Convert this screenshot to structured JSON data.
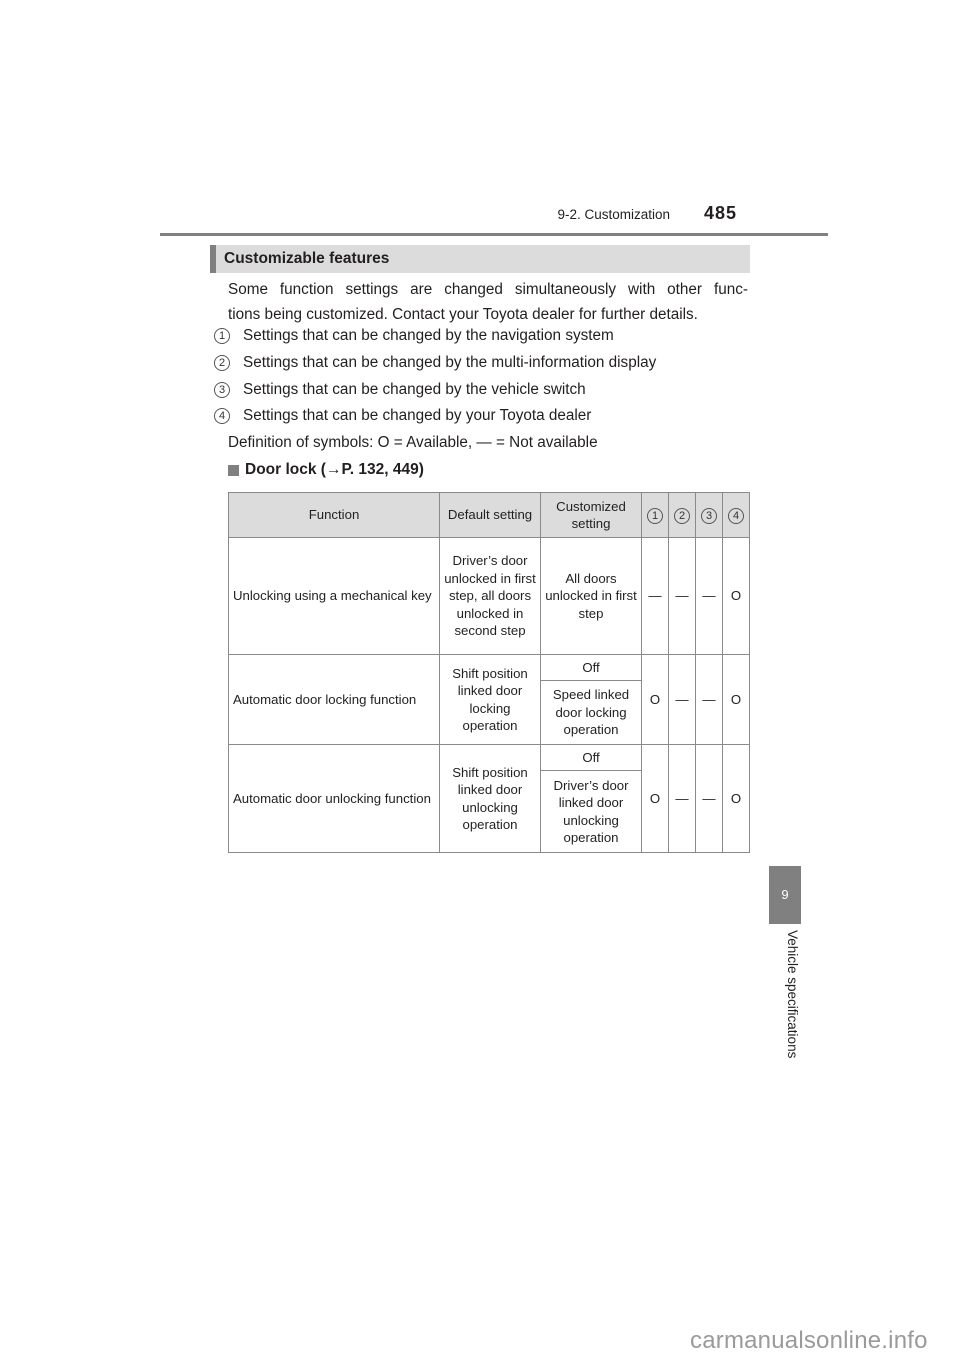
{
  "header": {
    "section": "9-2. Customization",
    "page_number": "485"
  },
  "section": {
    "title": "Customizable features"
  },
  "intro": {
    "line1": "Some function settings are changed simultaneously with other func-",
    "line2": "tions being customized. Contact your Toyota dealer for further details."
  },
  "legend": [
    {
      "num": "1",
      "text": "Settings that can be changed by the navigation system"
    },
    {
      "num": "2",
      "text": "Settings that can be changed by the multi-information display"
    },
    {
      "num": "3",
      "text": "Settings that can be changed by the vehicle switch"
    },
    {
      "num": "4",
      "text": "Settings that can be changed by your Toyota dealer"
    }
  ],
  "definitions": "Definition of symbols: O = Available, — = Not available",
  "subsection": {
    "title": "Door lock (→P. 132, 449)"
  },
  "table": {
    "headers": {
      "function": "Function",
      "default": "Default setting",
      "customized": "Customized setting",
      "c1": "1",
      "c2": "2",
      "c3": "3",
      "c4": "4"
    },
    "rows": [
      {
        "function": "Unlocking using a mechanical key",
        "default": "Driver’s door unlocked in first step, all doors unlocked in second step",
        "customized": [
          "All doors unlocked in first step"
        ],
        "marks": [
          "—",
          "—",
          "—",
          "O"
        ]
      },
      {
        "function": "Automatic door locking function",
        "default": "Shift position linked door locking operation",
        "customized": [
          "Off",
          "Speed linked door locking operation"
        ],
        "marks": [
          "O",
          "—",
          "—",
          "O"
        ]
      },
      {
        "function": "Automatic door unlocking function",
        "default": "Shift position linked door unlocking operation",
        "customized": [
          "Off",
          "Driver’s door linked door unlocking operation"
        ],
        "marks": [
          "O",
          "—",
          "—",
          "O"
        ]
      }
    ]
  },
  "side_tab": {
    "number": "9",
    "label": "Vehicle specifications"
  },
  "watermark": "carmanualsonline.info"
}
